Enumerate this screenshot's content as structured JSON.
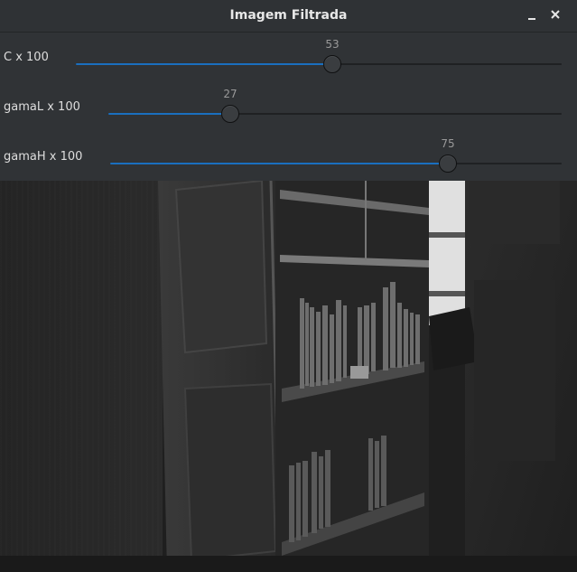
{
  "window": {
    "title": "Imagem Filtrada"
  },
  "sliders": [
    {
      "label": "C x 100",
      "value": "53",
      "fraction": 0.53
    },
    {
      "label": "gamaL x 100",
      "value": "27",
      "fraction": 0.27
    },
    {
      "label": "gamaH x 100",
      "value": "75",
      "fraction": 0.75
    }
  ],
  "icons": {
    "minimize": "minimize-icon",
    "close": "close-icon"
  }
}
